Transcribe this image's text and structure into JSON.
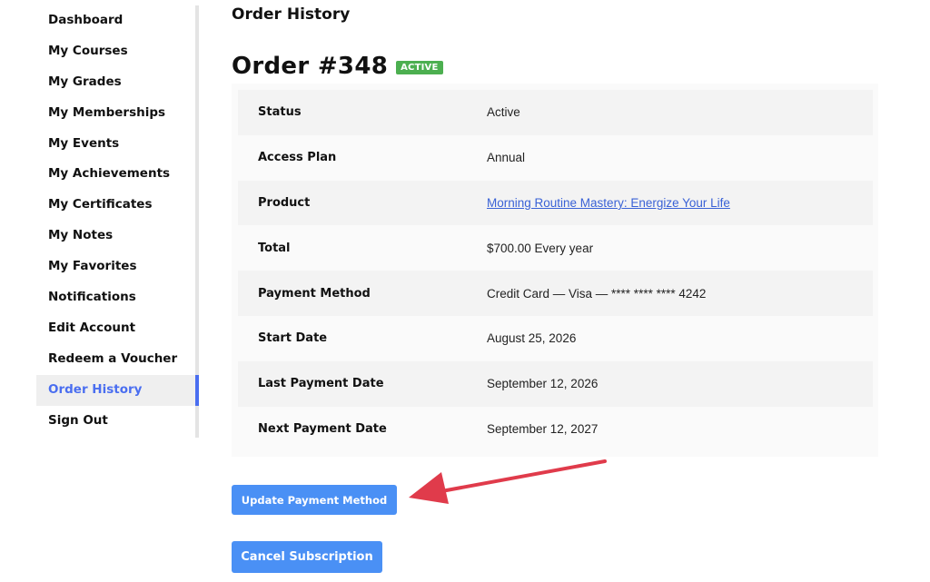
{
  "sidebar": {
    "items": [
      {
        "label": "Dashboard"
      },
      {
        "label": "My Courses"
      },
      {
        "label": "My Grades"
      },
      {
        "label": "My Memberships"
      },
      {
        "label": "My Events"
      },
      {
        "label": "My Achievements"
      },
      {
        "label": "My Certificates"
      },
      {
        "label": "My Notes"
      },
      {
        "label": "My Favorites"
      },
      {
        "label": "Notifications"
      },
      {
        "label": "Edit Account"
      },
      {
        "label": "Redeem a Voucher"
      },
      {
        "label": "Order History"
      },
      {
        "label": "Sign Out"
      }
    ],
    "active_item": "Order History"
  },
  "page": {
    "heading": "Order History",
    "order_title": "Order #348",
    "status_badge": "ACTIVE"
  },
  "details": {
    "rows": [
      {
        "label": "Status",
        "value": "Active"
      },
      {
        "label": "Access Plan",
        "value": "Annual"
      },
      {
        "label": "Product",
        "value": "Morning Routine Mastery: Energize Your Life"
      },
      {
        "label": "Total",
        "value": "$700.00 Every year"
      },
      {
        "label": "Payment Method",
        "value": "Credit Card — Visa — **** **** **** 4242"
      },
      {
        "label": "Start Date",
        "value": "August 25, 2026"
      },
      {
        "label": "Last Payment Date",
        "value": "September 12, 2026"
      },
      {
        "label": "Next Payment Date",
        "value": "September 12, 2027"
      }
    ]
  },
  "actions": {
    "update_payment_label": "Update Payment Method",
    "cancel_subscription_label": "Cancel Subscription"
  },
  "colors": {
    "accent": "#4a6ef0",
    "button": "#4a90f5",
    "badge": "#4caf50",
    "link": "#3a62d6",
    "annotation_arrow": "#e03b4b"
  }
}
